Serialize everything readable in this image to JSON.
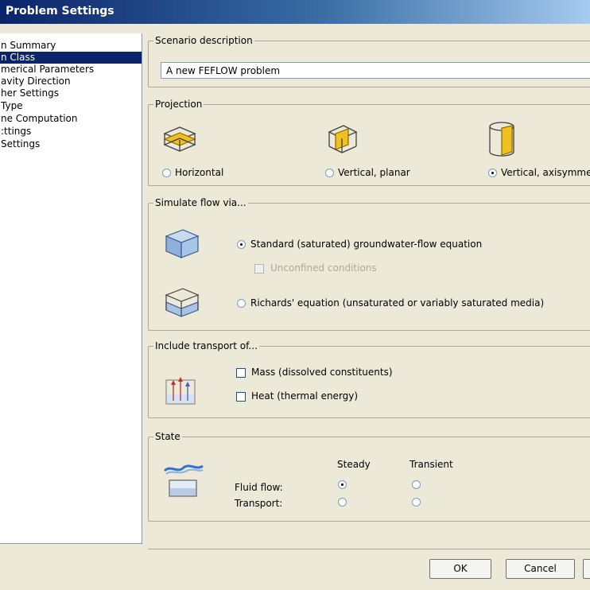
{
  "window": {
    "title": "Problem Settings"
  },
  "nav": {
    "items": [
      {
        "label": "n Summary",
        "selected": false
      },
      {
        "label": "n Class",
        "selected": true
      },
      {
        "label": "merical Parameters",
        "selected": false
      },
      {
        "label": "avity Direction",
        "selected": false
      },
      {
        "label": "her Settings",
        "selected": false
      },
      {
        "label": " Type",
        "selected": false
      },
      {
        "label": "ne Computation",
        "selected": false
      },
      {
        "label": ":ttings",
        "selected": false
      },
      {
        "label": "Settings",
        "selected": false
      }
    ]
  },
  "scenario": {
    "legend": "Scenario description",
    "value": "A new FEFLOW problem"
  },
  "projection": {
    "legend": "Projection",
    "options": [
      {
        "label": "Horizontal",
        "selected": false,
        "icon": "horizontal-projection-icon"
      },
      {
        "label": "Vertical, planar",
        "selected": false,
        "icon": "vertical-planar-icon"
      },
      {
        "label": "Vertical, axisymmet",
        "selected": true,
        "icon": "vertical-axisymmetric-icon"
      }
    ]
  },
  "simulate": {
    "legend": "Simulate flow via...",
    "standard_label": "Standard (saturated) groundwater-flow equation",
    "standard_selected": true,
    "unconfined_label": "Unconfined conditions",
    "unconfined_checked": false,
    "richards_label": "Richards' equation (unsaturated or variably saturated media)",
    "richards_selected": false
  },
  "transport": {
    "legend": "Include transport of...",
    "mass_label": "Mass (dissolved constituents)",
    "mass_checked": false,
    "heat_label": "Heat (thermal energy)",
    "heat_checked": false
  },
  "state": {
    "legend": "State",
    "col_steady": "Steady",
    "col_transient": "Transient",
    "rows": [
      {
        "label": "Fluid flow:",
        "value": "Steady"
      },
      {
        "label": "Transport:",
        "value": ""
      }
    ]
  },
  "buttons": {
    "ok": "OK",
    "cancel": "Cancel"
  },
  "colors": {
    "title_bar": "#0a246a",
    "selection": "#0a246a",
    "accent_yellow": "#f0c020",
    "water_blue": "#7fa8d8"
  }
}
